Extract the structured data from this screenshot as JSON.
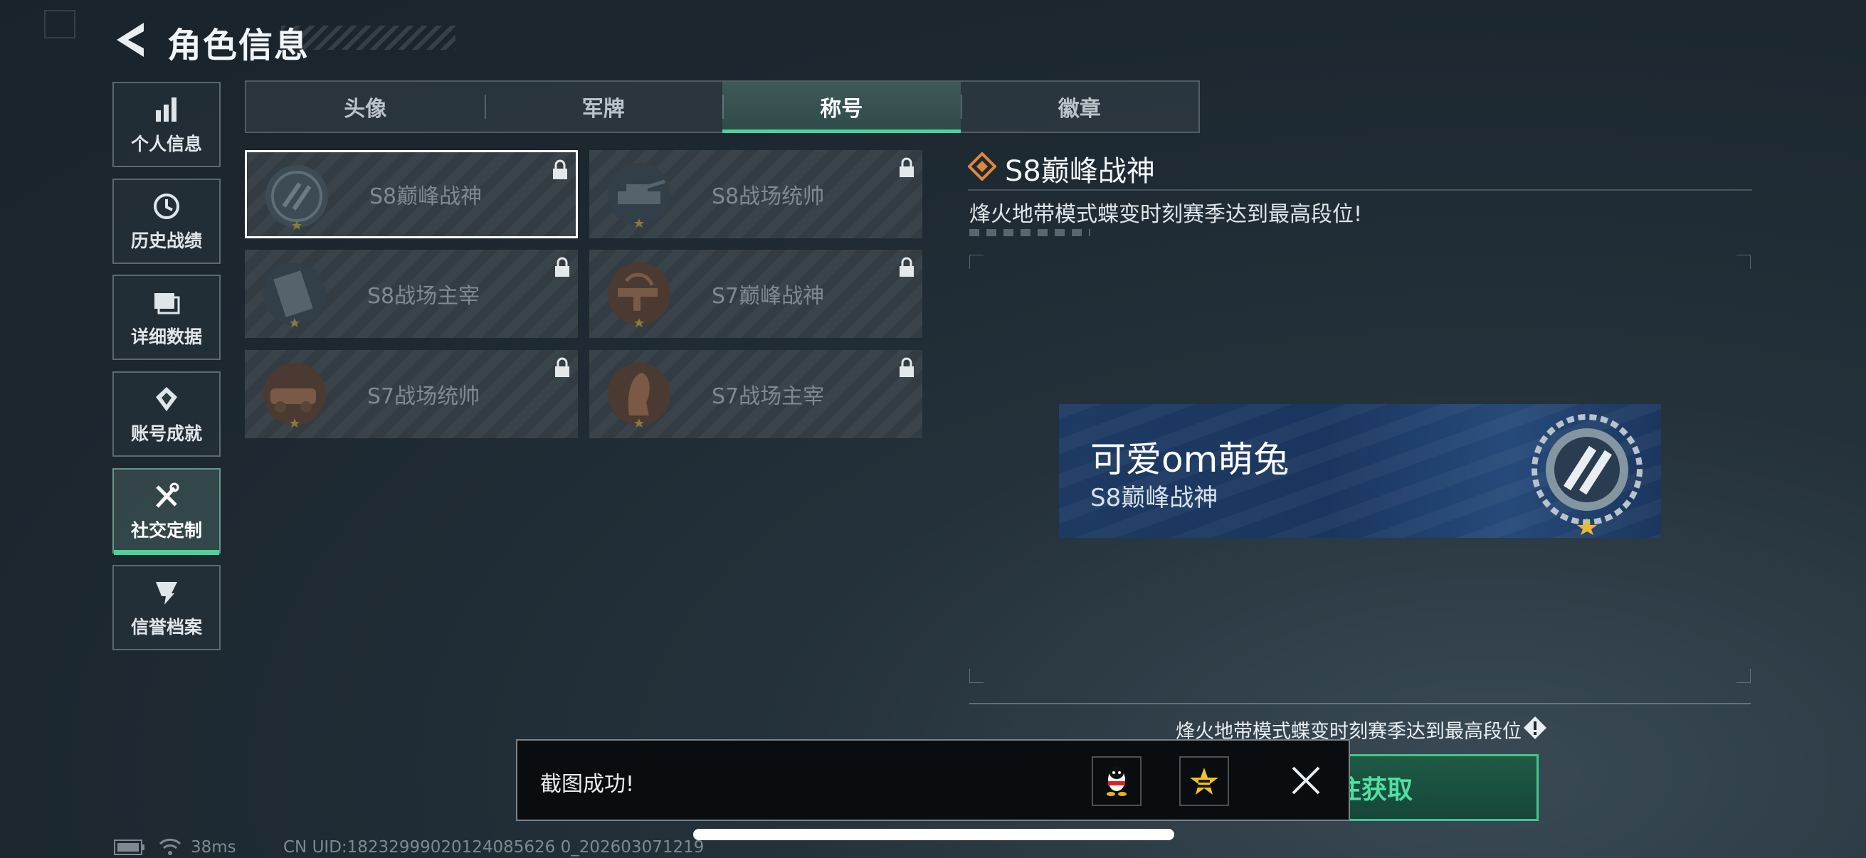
{
  "header": {
    "title": "角色信息"
  },
  "sidebar": {
    "items": [
      {
        "label": "个人信息",
        "icon": "bar-chart-icon"
      },
      {
        "label": "历史战绩",
        "icon": "history-clock-icon"
      },
      {
        "label": "详细数据",
        "icon": "folder-icon"
      },
      {
        "label": "账号成就",
        "icon": "achievement-icon"
      },
      {
        "label": "社交定制",
        "icon": "tools-icon",
        "active": true
      },
      {
        "label": "信誉档案",
        "icon": "credit-shield-icon"
      }
    ]
  },
  "tabs": [
    {
      "label": "头像"
    },
    {
      "label": "军牌"
    },
    {
      "label": "称号",
      "active": true
    },
    {
      "label": "徽章"
    }
  ],
  "titles": [
    {
      "name": "S8巅峰战神",
      "locked": true,
      "selected": true
    },
    {
      "name": "S8战场统帅",
      "locked": true
    },
    {
      "name": "S8战场主宰",
      "locked": true
    },
    {
      "name": "S7巅峰战神",
      "locked": true
    },
    {
      "name": "S7战场统帅",
      "locked": true
    },
    {
      "name": "S7战场主宰",
      "locked": true
    }
  ],
  "detail": {
    "title": "S8巅峰战神",
    "description": "烽火地带模式蝶变时刻赛季达到最高段位!",
    "preview_player": "可爱om萌兔",
    "preview_title": "S8巅峰战神",
    "requirement": "烽火地带模式蝶变时刻赛季达到最高段位",
    "get_button": "前往获取"
  },
  "toast": {
    "text": "截图成功!"
  },
  "status": {
    "ping": "38ms",
    "uid": "CN UID:18232999020124085626 0_202603071219"
  },
  "colors": {
    "accent": "#4cd39a",
    "preview_bg": "#1d3a63"
  }
}
